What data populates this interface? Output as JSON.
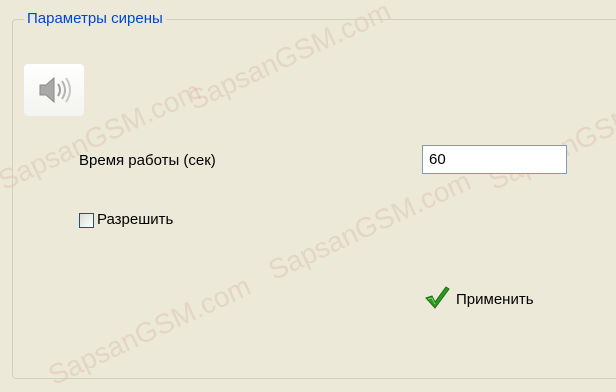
{
  "group": {
    "title": "Параметры сирены"
  },
  "icons": {
    "speaker": "speaker-volume-icon",
    "apply": "green-checkmark-icon"
  },
  "settings": {
    "time_label": "Время работы (сек)",
    "time_value": "60",
    "enable_label": "Разрешить",
    "enable_checked": false
  },
  "actions": {
    "apply_label": "Применить"
  },
  "watermark": {
    "text": "SapsanGSM.com"
  },
  "colors": {
    "background": "#ece9d8",
    "legend_text": "#0046d5",
    "input_border": "#7f9db9",
    "checkmark": "#2e9a1e"
  }
}
